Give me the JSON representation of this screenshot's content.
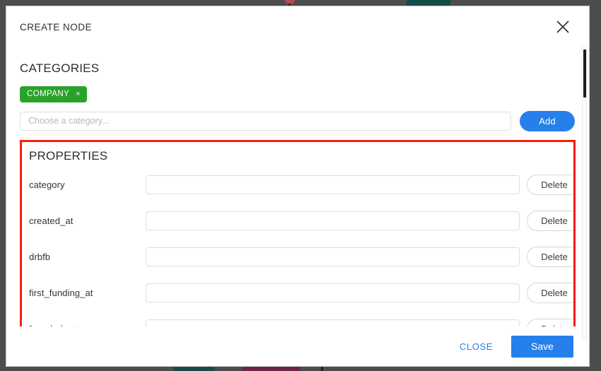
{
  "modal": {
    "title": "CREATE NODE",
    "close_icon": "close-icon"
  },
  "categories": {
    "heading": "CATEGORIES",
    "chips": [
      {
        "label": "COMPANY",
        "remove_icon": "×",
        "color": "#2aa22a"
      }
    ],
    "input": {
      "placeholder": "Choose a category...",
      "value": ""
    },
    "add_label": "Add"
  },
  "properties": {
    "heading": "PROPERTIES",
    "delete_label": "Delete",
    "rows": [
      {
        "label": "category",
        "value": ""
      },
      {
        "label": "created_at",
        "value": ""
      },
      {
        "label": "drbfb",
        "value": ""
      },
      {
        "label": "first_funding_at",
        "value": ""
      },
      {
        "label": "founded_at",
        "value": ""
      }
    ]
  },
  "footer": {
    "close_label": "CLOSE",
    "save_label": "Save"
  },
  "colors": {
    "accent_blue": "#2680eb",
    "chip_green": "#2aa22a",
    "annotation_red": "#f81d05",
    "backdrop": "#4d4d4d"
  }
}
